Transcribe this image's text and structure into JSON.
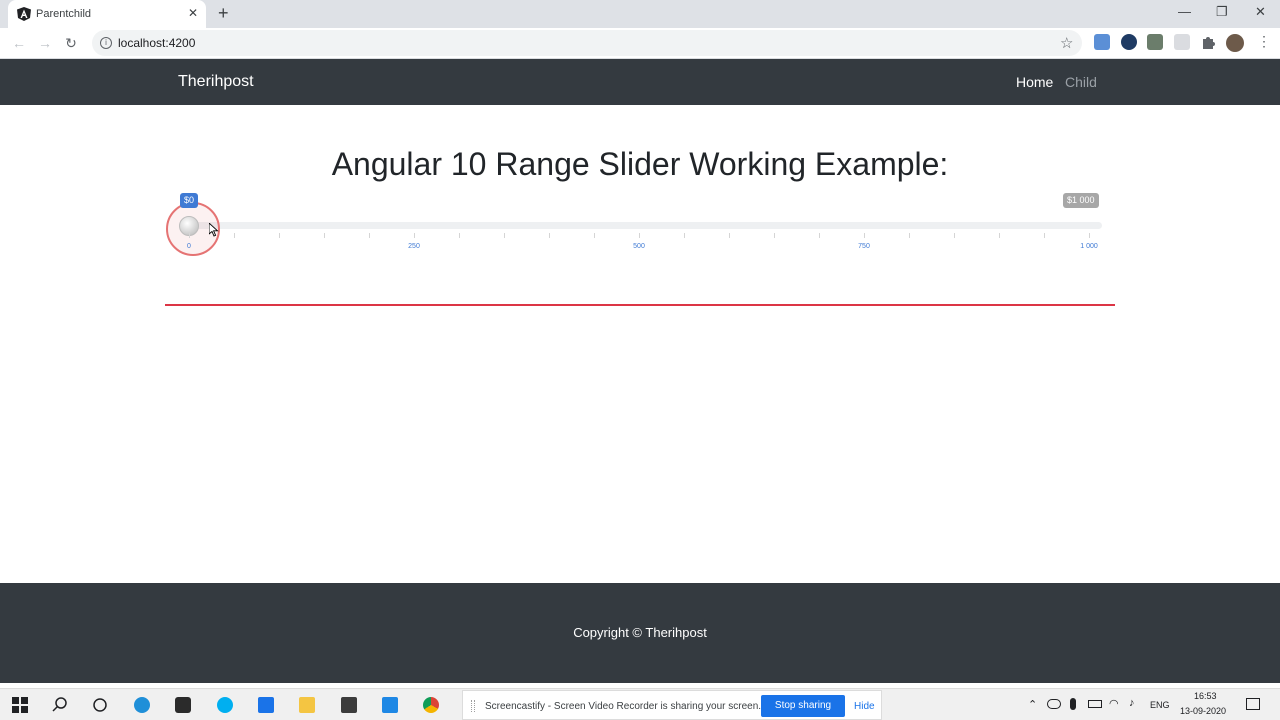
{
  "browser": {
    "tab_title": "Parentchild",
    "tab_close": "✕",
    "new_tab": "+",
    "url": "localhost:4200",
    "window_controls": {
      "minimize": "—",
      "restore": "❐",
      "close": "✕"
    }
  },
  "navbar": {
    "brand": "Therihpost",
    "links": [
      {
        "label": "Home",
        "active": true
      },
      {
        "label": "Child",
        "active": false
      }
    ]
  },
  "main": {
    "heading": "Angular 10 Range Slider Working Example:"
  },
  "slider": {
    "min": 0,
    "max": 1000,
    "value": 0,
    "value_label": "$0",
    "max_label": "$1 000",
    "tick_labels": [
      "0",
      "250",
      "500",
      "750",
      "1 000"
    ]
  },
  "footer": {
    "copyright": "Copyright © Therihpost"
  },
  "screen_share": {
    "message": "Screencastify - Screen Video Recorder is sharing your screen.",
    "stop_label": "Stop sharing",
    "hide_label": "Hide"
  },
  "system_tray": {
    "language": "ENG",
    "time": "16:53",
    "date": "13-09-2020"
  },
  "colors": {
    "navbar_bg": "#343a40",
    "slider_accent": "#3f7ad4",
    "divider_red": "#dc3545",
    "share_button": "#1a73e8"
  }
}
